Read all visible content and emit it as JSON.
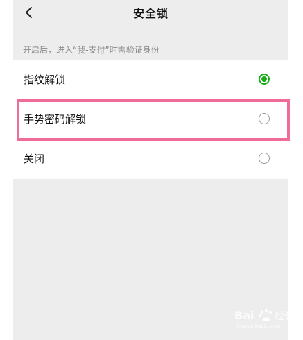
{
  "nav": {
    "title": "安全锁",
    "back_icon": "chevron-left-icon"
  },
  "hint": "开启后，进入“我-支付”时需验证身份",
  "options": [
    {
      "label": "指纹解锁",
      "selected": true
    },
    {
      "label": "手势密码解锁",
      "selected": false
    },
    {
      "label": "关闭",
      "selected": false
    }
  ],
  "highlight_color": "#f06b97",
  "accent_color": "#1aad19",
  "watermark": {
    "logo_text": "Bai 经验",
    "sub_text": "jingyan.baidu.com"
  }
}
